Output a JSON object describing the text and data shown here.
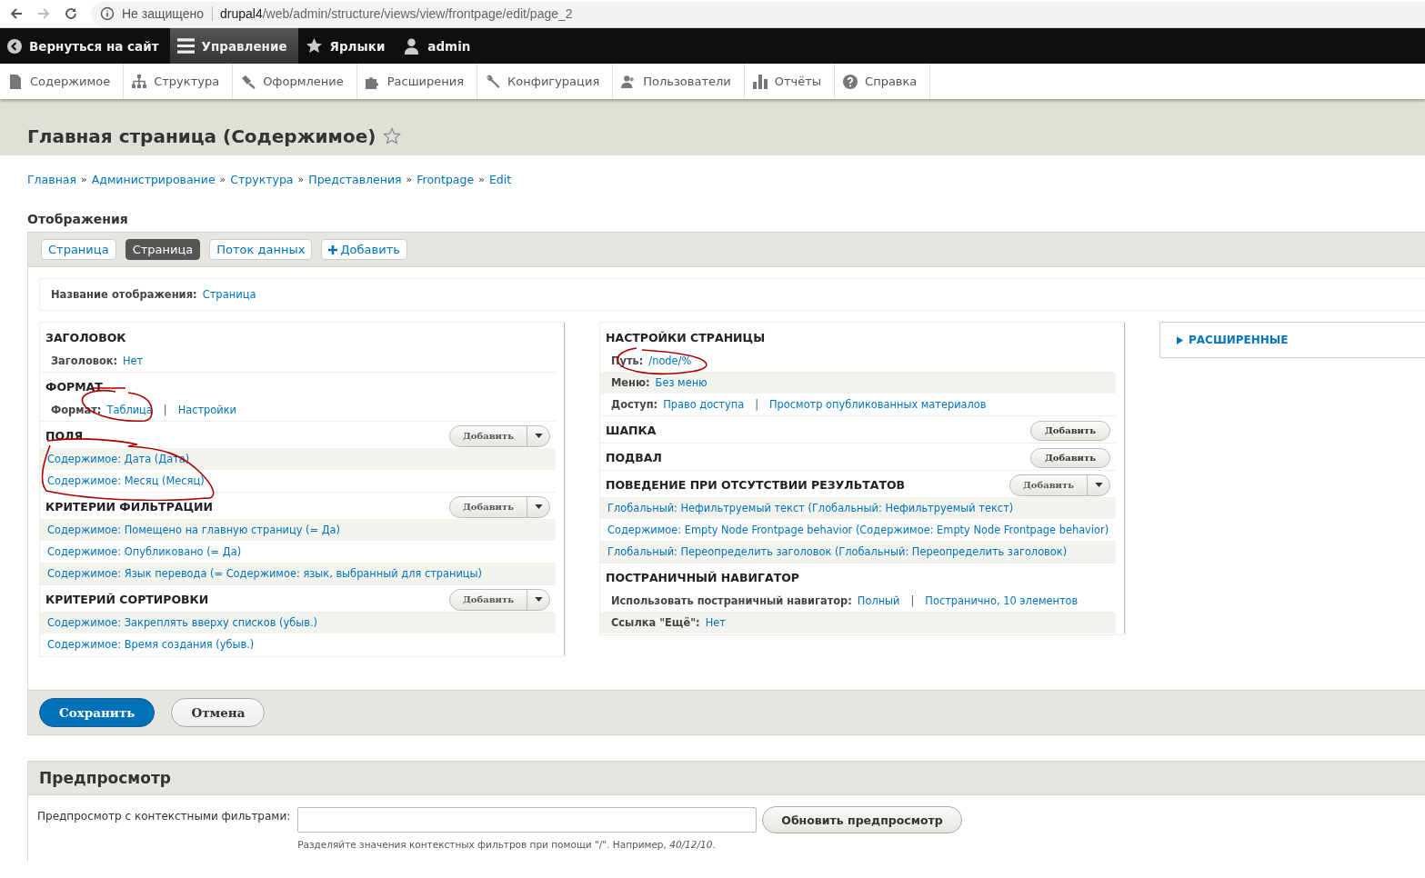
{
  "browser": {
    "security": "Не защищено",
    "url_host": "drupal4",
    "url_path": "/web/admin/structure/views/view/frontpage/edit/page_2"
  },
  "toolbar": [
    {
      "label": "Вернуться на сайт",
      "selected": false
    },
    {
      "label": "Управление",
      "selected": true
    },
    {
      "label": "Ярлыки",
      "selected": false
    },
    {
      "label": "admin",
      "selected": false
    }
  ],
  "tray": [
    "Содержимое",
    "Структура",
    "Оформление",
    "Расширения",
    "Конфигурация",
    "Пользователи",
    "Отчёты",
    "Справка"
  ],
  "page_title": "Главная страница (Содержимое)",
  "breadcrumbs": [
    {
      "label": "Главная"
    },
    {
      "sep": "»",
      "label": "Администрирование"
    },
    {
      "sep": "»",
      "label": "Структура"
    },
    {
      "sep": "»",
      "label": "Представления"
    },
    {
      "sep": "»",
      "label": "Frontpage"
    },
    {
      "sep": "»",
      "label": "Edit"
    }
  ],
  "displays_heading": "Отображения",
  "display_tabs": [
    {
      "label": "Страница",
      "selected": false,
      "kind": "tab"
    },
    {
      "label": "Страница",
      "selected": true,
      "kind": "tab"
    },
    {
      "label": "Поток данных",
      "selected": false,
      "kind": "tab"
    },
    {
      "label": "Добавить",
      "selected": false,
      "kind": "add"
    }
  ],
  "display_name": {
    "label": "Название отображения:",
    "value": "Страница"
  },
  "columns": [
    {
      "sections": [
        {
          "title": "ЗАГОЛОВОК",
          "rows": [
            {
              "kind": "setting",
              "label": "Заголовок:",
              "links": [
                "Нет"
              ]
            }
          ]
        },
        {
          "title": "ФОРМАТ",
          "rows": [
            {
              "kind": "setting",
              "label": "Формат:",
              "links": [
                "Таблица",
                "Настройки"
              ],
              "separator": "|"
            }
          ]
        },
        {
          "title": "ПОЛЯ",
          "button": {
            "label": "Добавить",
            "kind": "dropdown"
          },
          "rows": [
            {
              "kind": "link",
              "links": [
                "Содержимое: Дата (Дата)"
              ]
            },
            {
              "kind": "link",
              "links": [
                "Содержимое: Месяц (Месяц)"
              ]
            }
          ]
        },
        {
          "title": "КРИТЕРИИ ФИЛЬТРАЦИИ",
          "button": {
            "label": "Добавить",
            "kind": "dropdown"
          },
          "rows": [
            {
              "kind": "link",
              "links": [
                "Содержимое: Помещено на главную страницу (= Да)"
              ]
            },
            {
              "kind": "link",
              "links": [
                "Содержимое: Опубликовано (= Да)"
              ]
            },
            {
              "kind": "link",
              "links": [
                "Содержимое: Язык перевода (= Содержимое: язык, выбранный для страницы)"
              ]
            }
          ]
        },
        {
          "title": "КРИТЕРИЙ СОРТИРОВКИ",
          "button": {
            "label": "Добавить",
            "kind": "dropdown"
          },
          "rows": [
            {
              "kind": "link",
              "links": [
                "Содержимое: Закреплять вверху списков (убыв.)"
              ]
            },
            {
              "kind": "link",
              "links": [
                "Содержимое: Время создания (убыв.)"
              ]
            }
          ]
        }
      ]
    },
    {
      "sections": [
        {
          "title": "НАСТРОЙКИ СТРАНИЦЫ",
          "rows": [
            {
              "kind": "setting",
              "label": "Путь:",
              "links": [
                "/node/%"
              ]
            },
            {
              "kind": "setting",
              "label": "Меню:",
              "links": [
                "Без меню"
              ]
            },
            {
              "kind": "setting",
              "label": "Доступ:",
              "links": [
                "Право доступа",
                "Просмотр опубликованных материалов"
              ],
              "separator": "|"
            }
          ]
        },
        {
          "title": "ШАПКА",
          "button": {
            "label": "Добавить",
            "kind": "plain"
          }
        },
        {
          "title": "ПОДВАЛ",
          "button": {
            "label": "Добавить",
            "kind": "plain"
          }
        },
        {
          "title": "ПОВЕДЕНИЕ ПРИ ОТСУТСТВИИ РЕЗУЛЬТАТОВ",
          "button": {
            "label": "Добавить",
            "kind": "dropdown"
          },
          "rows": [
            {
              "kind": "link",
              "links": [
                "Глобальный: Нефильтруемый текст (Глобальный: Нефильтруемый текст)"
              ]
            },
            {
              "kind": "link",
              "links": [
                "Содержимое: Empty Node Frontpage behavior (Содержимое: Empty Node Frontpage behavior)"
              ]
            },
            {
              "kind": "link",
              "links": [
                "Глобальный: Переопределить заголовок (Глобальный: Переопределить заголовок)"
              ]
            }
          ]
        },
        {
          "title": "ПОСТРАНИЧНЫЙ НАВИГАТОР",
          "rows": [
            {
              "kind": "setting",
              "label": "Использовать постраничный навигатор:",
              "links": [
                "Полный",
                "Постранично, 10 элементов"
              ],
              "separator": "|"
            },
            {
              "kind": "setting",
              "label": "Ссылка \"Ещё\":",
              "links": [
                "Нет"
              ]
            }
          ]
        }
      ]
    }
  ],
  "advanced": {
    "label": "РАСШИРЕННЫЕ",
    "expanded": false
  },
  "actions": [
    {
      "label": "Сохранить",
      "kind": "primary"
    },
    {
      "label": "Отмена",
      "kind": "secondary"
    }
  ],
  "preview": {
    "title": "Предпросмотр",
    "field_label": "Предпросмотр с контекстными фильтрами:",
    "button": "Обновить предпросмотр",
    "hint": "Разделяйте значения контекстных фильтров при помощи \"/\". Например, *40/12/10*."
  }
}
